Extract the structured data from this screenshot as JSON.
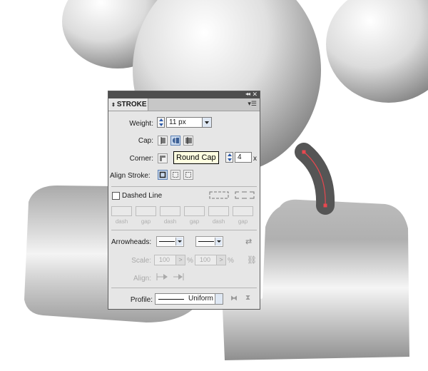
{
  "panel": {
    "title": "STROKE",
    "weight": {
      "label": "Weight:",
      "value": "11 px"
    },
    "cap": {
      "label": "Cap:",
      "options": [
        "butt-cap",
        "round-cap",
        "projecting-cap"
      ],
      "selected": "round-cap"
    },
    "corner": {
      "label": "Corner:",
      "limit_label": "t:",
      "limit_value": "4",
      "limit_suffix": "x"
    },
    "align_stroke": {
      "label": "Align Stroke:"
    },
    "dashed": {
      "label": "Dashed Line",
      "checked": false,
      "slots": [
        "dash",
        "gap",
        "dash",
        "gap",
        "dash",
        "gap"
      ]
    },
    "arrowheads": {
      "label": "Arrowheads:"
    },
    "scale": {
      "label": "Scale:",
      "start": "100",
      "end": "100",
      "unit": "%"
    },
    "align": {
      "label": "Align:"
    },
    "profile": {
      "label": "Profile:",
      "value": "Uniform"
    }
  },
  "tooltip": {
    "text": "Round Cap"
  },
  "colors": {
    "panel_bg": "#e6e6e6",
    "titlebar": "#4e4e4e",
    "handle_stroke": "#555555",
    "path_highlight": "#e8474f"
  }
}
